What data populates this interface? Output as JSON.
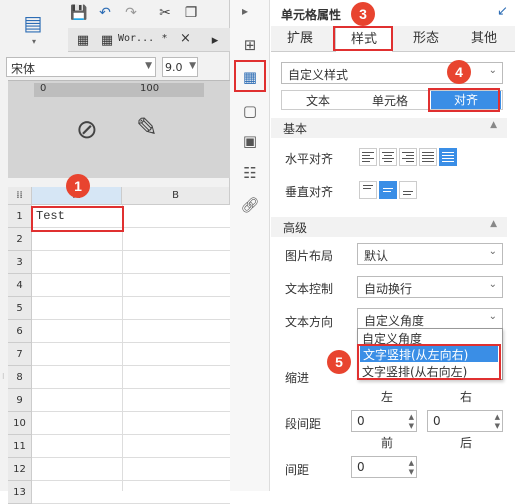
{
  "toolbar": {
    "file_tab_label": "Wor...",
    "file_tab_modified": "*",
    "file_tab_close": "×",
    "font_name": "宋体",
    "font_size": "9.0"
  },
  "ruler": {
    "marks": [
      "0",
      "100"
    ]
  },
  "sheet": {
    "columns": [
      "A",
      "B"
    ],
    "rows": [
      "1",
      "2",
      "3",
      "4",
      "5",
      "6",
      "7",
      "8",
      "9",
      "10",
      "11",
      "12",
      "13"
    ],
    "cell_a1": "Test"
  },
  "panel": {
    "title": "单元格属性",
    "tabs": [
      "扩展",
      "样式",
      "形态",
      "其他"
    ],
    "active_tab": "样式",
    "style_select": "自定义样式",
    "subtabs": [
      "文本",
      "单元格",
      "对齐"
    ],
    "active_subtab": "对齐",
    "basic_section": "基本",
    "h_align_label": "水平对齐",
    "v_align_label": "垂直对齐",
    "advanced_section": "高级",
    "image_layout_label": "图片布局",
    "image_layout_value": "默认",
    "text_control_label": "文本控制",
    "text_control_value": "自动换行",
    "text_dir_label": "文本方向",
    "text_dir_value": "自定义角度",
    "text_dir_options": [
      "自定义角度",
      "文字竖排(从左向右)",
      "文字竖排(从右向左)"
    ],
    "indent_label": "缩进",
    "indent_sub": [
      "左",
      "右"
    ],
    "para_spacing_label": "段间距",
    "para_spacing_values": [
      "0",
      "0"
    ],
    "para_spacing_sub": [
      "前",
      "后"
    ],
    "spacing_label": "间距",
    "spacing_value": "0"
  },
  "badges": [
    "1",
    "2",
    "3",
    "4",
    "5"
  ],
  "colors": {
    "accent": "#3a8ee6",
    "highlight_red": "#e03030",
    "badge": "#e8442f"
  }
}
